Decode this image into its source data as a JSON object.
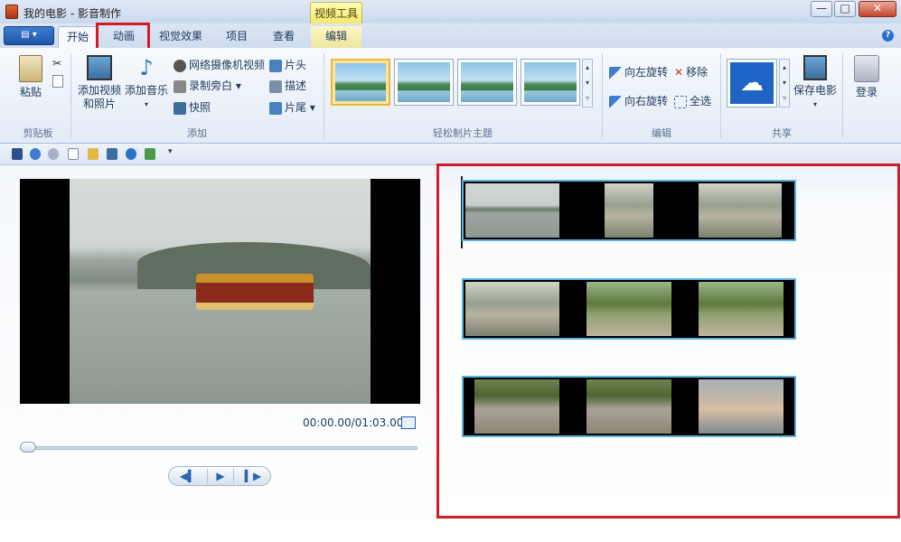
{
  "window": {
    "title": "我的电影 - 影音制作",
    "context_tab": "视频工具",
    "controls": {
      "minimize": "—",
      "maximize": "□",
      "close": "✕"
    }
  },
  "ribbon_tabs": [
    {
      "label": "开始"
    },
    {
      "label": "动画"
    },
    {
      "label": "视觉效果"
    },
    {
      "label": "项目"
    },
    {
      "label": "查看"
    },
    {
      "label": "编辑"
    }
  ],
  "help_label": "?",
  "groups": {
    "clipboard": {
      "label": "剪贴板",
      "paste": "粘贴"
    },
    "add": {
      "label": "添加",
      "add_video_line1": "添加视频",
      "add_video_line2": "和照片",
      "add_music": "添加音乐",
      "webcam": "网络摄像机视频",
      "narration": "录制旁白",
      "snapshot": "快照",
      "title": "片头",
      "caption": "描述",
      "credits": "片尾"
    },
    "themes": {
      "label": "轻松制片主题"
    },
    "edit": {
      "label": "编辑",
      "rotate_left": "向左旋转",
      "rotate_right": "向右旋转",
      "remove": "移除",
      "select_all": "全选"
    },
    "share": {
      "label": "共享",
      "save_movie": "保存电影",
      "sign_in": "登录"
    }
  },
  "preview": {
    "timecode": "00:00.00/01:03.00",
    "progress": 0.0,
    "prev_glyph": "◀▍",
    "play_glyph": "▶",
    "next_glyph": "▍▶"
  },
  "icons": {
    "app": "movie-maker-icon",
    "share": "onedrive-cloud-icon"
  },
  "colors": {
    "highlight": "#d21c24",
    "clip_border": "#5ab3dd"
  }
}
